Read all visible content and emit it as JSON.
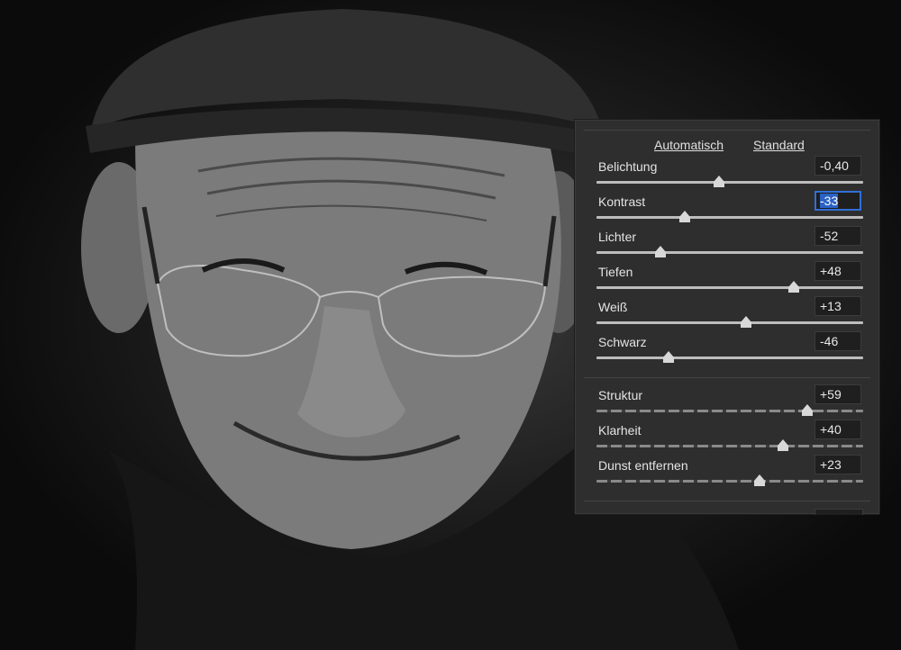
{
  "panel": {
    "auto_label": "Automatisch",
    "default_label": "Standard",
    "basic_sliders": [
      {
        "label": "Belichtung",
        "value": "-0,40",
        "position": 0.46
      },
      {
        "label": "Kontrast",
        "value": "-33",
        "position": 0.33,
        "active": true
      },
      {
        "label": "Lichter",
        "value": "-52",
        "position": 0.24
      },
      {
        "label": "Tiefen",
        "value": "+48",
        "position": 0.74
      },
      {
        "label": "Weiß",
        "value": "+13",
        "position": 0.56
      },
      {
        "label": "Schwarz",
        "value": "-46",
        "position": 0.27
      }
    ],
    "detail_sliders": [
      {
        "label": "Struktur",
        "value": "+59",
        "position": 0.79
      },
      {
        "label": "Klarheit",
        "value": "+40",
        "position": 0.7
      },
      {
        "label": "Dunst entfernen",
        "value": "+23",
        "position": 0.61
      }
    ]
  },
  "colors": {
    "panel_bg": "#2e2e2e",
    "selection": "#2b62c4",
    "focus_border": "#2f6fd6"
  }
}
